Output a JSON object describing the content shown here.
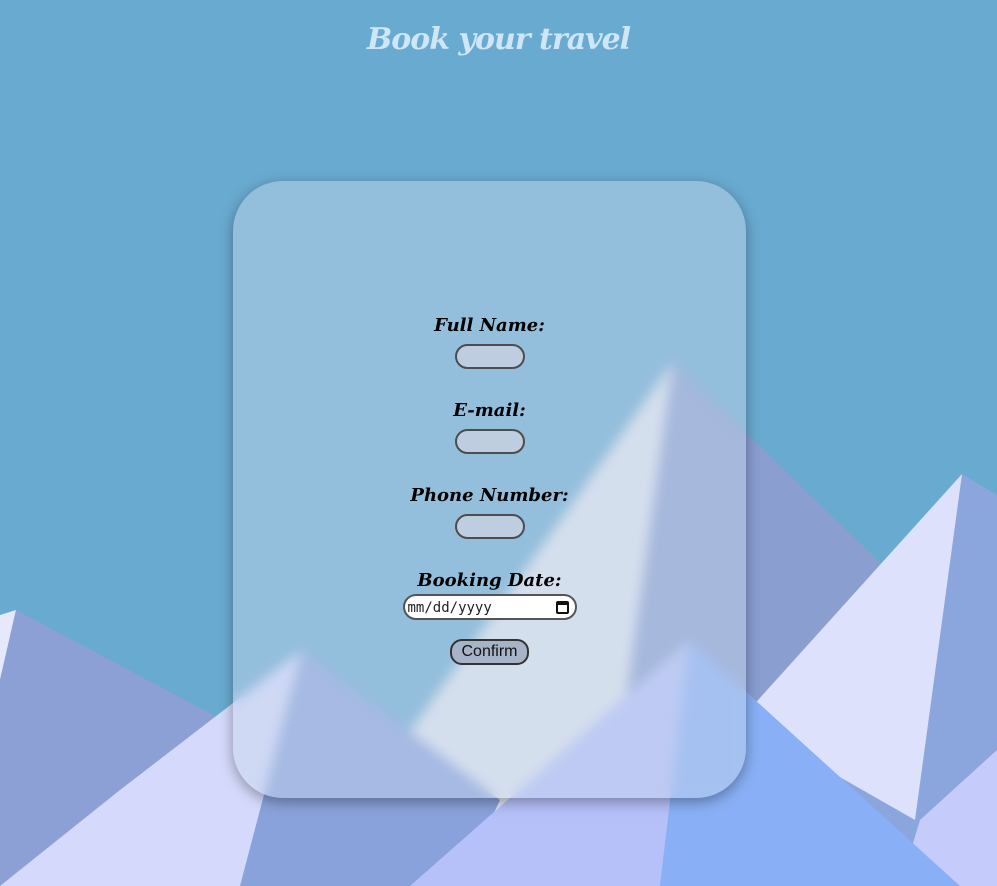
{
  "page": {
    "title": "Book your travel"
  },
  "form": {
    "full_name_label": "Full Name:",
    "email_label": "E-mail:",
    "phone_label": "Phone Number:",
    "booking_date_label": "Booking Date:",
    "booking_date_placeholder": "mm/dd/yyyy",
    "confirm_label": "Confirm"
  },
  "colors": {
    "sky": "#69aad0",
    "card": "#c8d7eb",
    "input_fill": "#bfcde0",
    "title": "#cfe6f6"
  }
}
